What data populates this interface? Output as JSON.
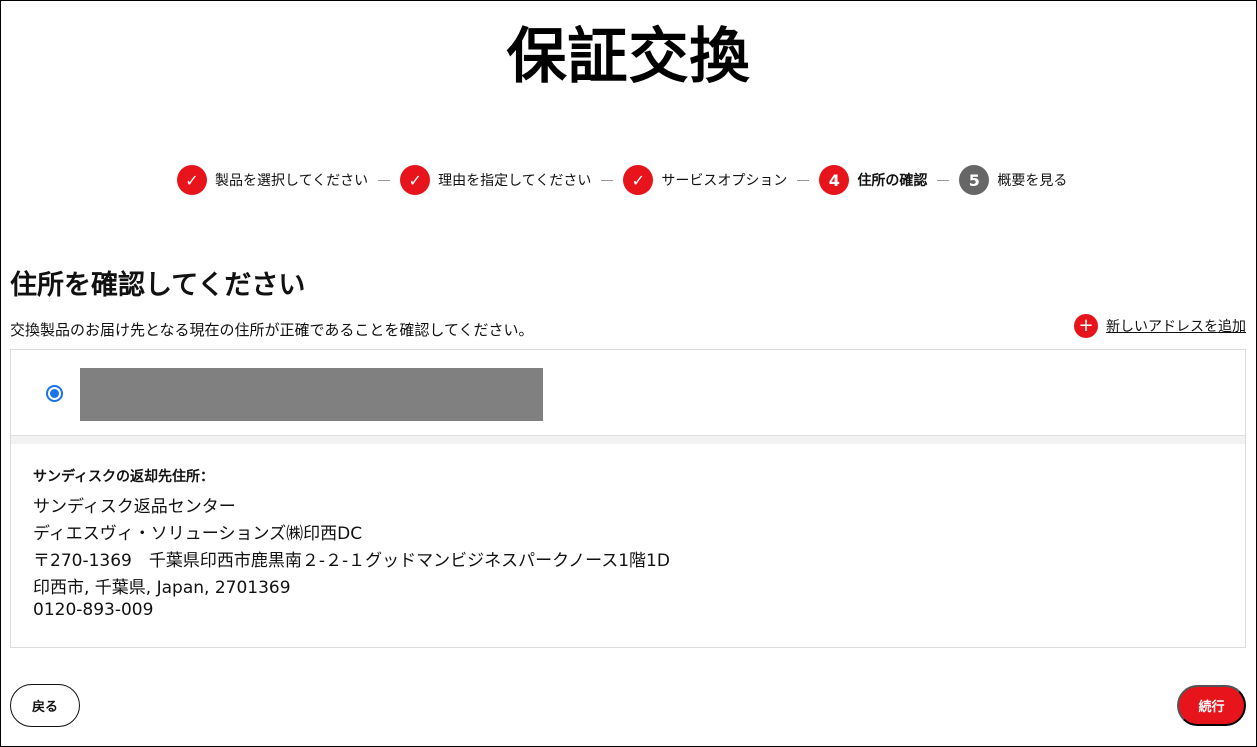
{
  "page": {
    "title": "保証交換"
  },
  "stepper": {
    "steps": [
      {
        "marker": "✓",
        "label": "製品を選択してください",
        "status": "done"
      },
      {
        "marker": "✓",
        "label": "理由を指定してください",
        "status": "done"
      },
      {
        "marker": "✓",
        "label": "サービスオプション",
        "status": "done"
      },
      {
        "marker": "4",
        "label": "住所の確認",
        "status": "active"
      },
      {
        "marker": "5",
        "label": "概要を見る",
        "status": "todo"
      }
    ],
    "separator": "—"
  },
  "section": {
    "heading": "住所を確認してください",
    "description": "交換製品のお届け先となる現在の住所が正確であることを確認してください。"
  },
  "add_address": {
    "icon": "+",
    "label": "新しいアドレスを追加"
  },
  "address_option": {
    "selected": true
  },
  "return_address": {
    "title": "サンディスクの返却先住所：",
    "lines": [
      "サンディスク返品センター",
      "ディエスヴィ・ソリューションズ㈱印西DC",
      "〒270-1369　千葉県印西市鹿黒南２-２-１グッドマンビジネスパークノース1階1D",
      "印西市, 千葉県, Japan, 2701369",
      "0120-893-009"
    ]
  },
  "buttons": {
    "back": "戻る",
    "continue": "続行"
  },
  "colors": {
    "accent": "#e8141c",
    "pending": "#666666",
    "radio": "#1a73e8",
    "redacted": "#808080"
  }
}
